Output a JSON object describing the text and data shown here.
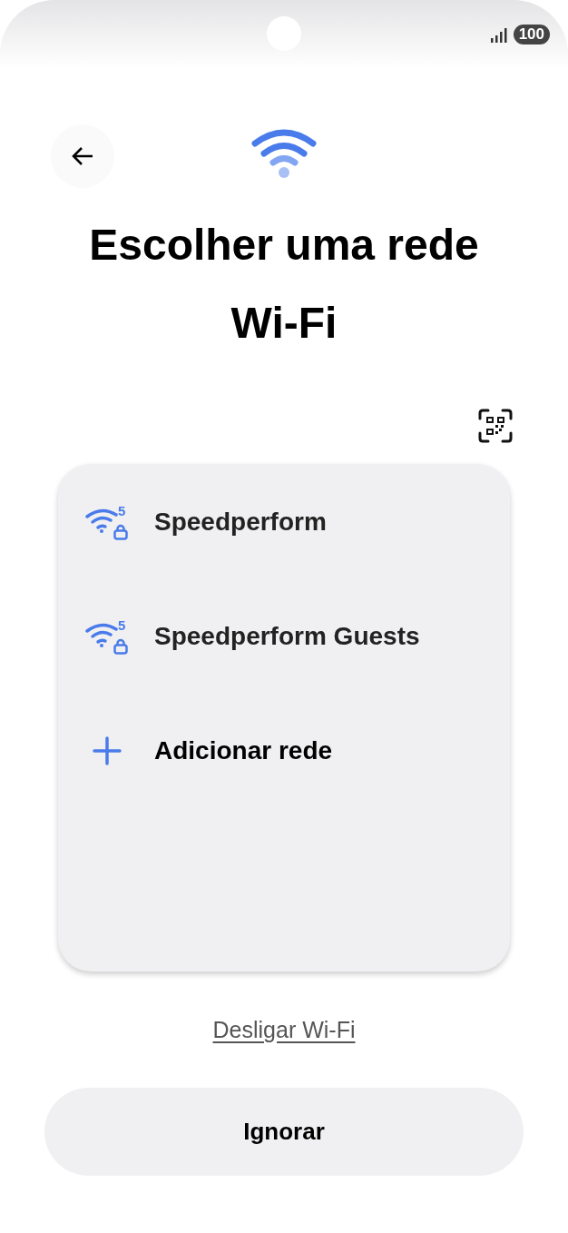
{
  "status_bar": {
    "battery": "100"
  },
  "title": "Escolher uma rede Wi-Fi",
  "networks": [
    {
      "kind": "network",
      "name": "Speedperform",
      "band": "5",
      "locked": true
    },
    {
      "kind": "network",
      "name": "Speedperform Guests",
      "band": "5",
      "locked": true
    },
    {
      "kind": "add",
      "name": "Adicionar rede"
    }
  ],
  "link": "Desligar Wi-Fi",
  "button": "Ignorar"
}
